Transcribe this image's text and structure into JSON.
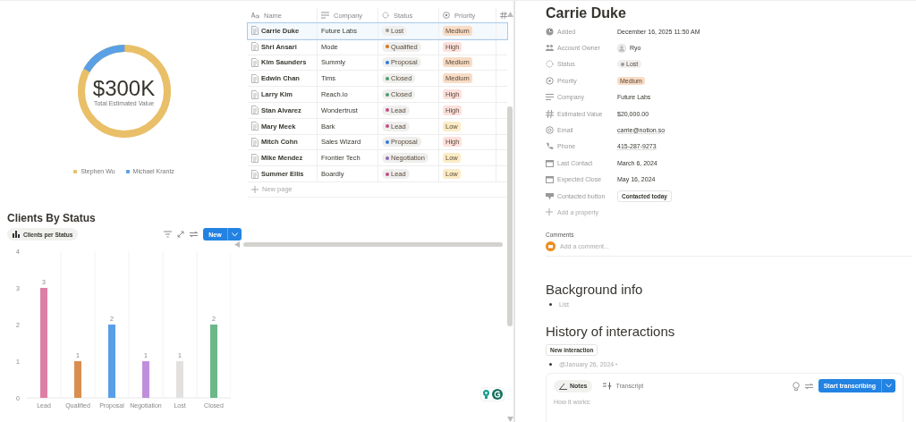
{
  "donut": {
    "value": "$300K",
    "caption": "Total Estimated Value",
    "legend": [
      {
        "name": "Stephen Wu",
        "color": "#e9bf68"
      },
      {
        "name": "Michael Krantz",
        "color": "#5aa0e6"
      }
    ]
  },
  "table": {
    "columns": [
      "Name",
      "Company",
      "Status",
      "Priority"
    ],
    "rows": [
      {
        "name": "Carrie Duke",
        "company": "Future Labs",
        "status": {
          "label": "Lost",
          "color": "#9b9a97"
        },
        "priority": {
          "label": "Medium",
          "color": "#f8dcc6"
        },
        "selected": true
      },
      {
        "name": "Shri Ansari",
        "company": "Mode",
        "status": {
          "label": "Qualified",
          "color": "#d9730d"
        },
        "priority": {
          "label": "High",
          "color": "#fde0dc"
        },
        "selected": false
      },
      {
        "name": "Kim Saunders",
        "company": "Summly",
        "status": {
          "label": "Proposal",
          "color": "#2e7dd7"
        },
        "priority": {
          "label": "Medium",
          "color": "#f8dcc6"
        },
        "selected": false
      },
      {
        "name": "Edwin Chan",
        "company": "Tims",
        "status": {
          "label": "Closed",
          "color": "#4d9a6c"
        },
        "priority": {
          "label": "Medium",
          "color": "#f8dcc6"
        },
        "selected": false
      },
      {
        "name": "Larry Kim",
        "company": "Reach.io",
        "status": {
          "label": "Closed",
          "color": "#4d9a6c"
        },
        "priority": {
          "label": "High",
          "color": "#fde0dc"
        },
        "selected": false
      },
      {
        "name": "Stan Alvarez",
        "company": "Wondertrust",
        "status": {
          "label": "Lead",
          "color": "#c14c8a"
        },
        "priority": {
          "label": "High",
          "color": "#fde0dc"
        },
        "selected": false
      },
      {
        "name": "Mary Meek",
        "company": "Bark",
        "status": {
          "label": "Lead",
          "color": "#c14c8a"
        },
        "priority": {
          "label": "Low",
          "color": "#fcecc6"
        },
        "selected": false
      },
      {
        "name": "Mitch Cohn",
        "company": "Sales Wizard",
        "status": {
          "label": "Proposal",
          "color": "#2e7dd7"
        },
        "priority": {
          "label": "High",
          "color": "#fde0dc"
        },
        "selected": false
      },
      {
        "name": "Mike Mendez",
        "company": "Frontier Tech",
        "status": {
          "label": "Negotiation",
          "color": "#9065b0"
        },
        "priority": {
          "label": "Low",
          "color": "#fcecc6"
        },
        "selected": false
      },
      {
        "name": "Summer Ellis",
        "company": "Boardly",
        "status": {
          "label": "Lead",
          "color": "#c14c8a"
        },
        "priority": {
          "label": "Low",
          "color": "#fcecc6"
        },
        "selected": false
      }
    ],
    "new_page": "New page"
  },
  "chart_section": {
    "title": "Clients By Status",
    "view_tab": "Clients per Status",
    "new_button": "New",
    "chart_data": {
      "type": "bar",
      "categories": [
        "Lead",
        "Qualified",
        "Proposal",
        "Negotiation",
        "Lost",
        "Closed"
      ],
      "values": [
        3,
        1,
        2,
        1,
        1,
        2
      ],
      "colors": [
        "#de7fa6",
        "#d98e4f",
        "#5a9ee8",
        "#c08fdc",
        "#e2e1df",
        "#6cb88a"
      ],
      "ylim": [
        0,
        4
      ],
      "yticks": [
        0,
        1,
        2,
        3,
        4
      ],
      "data_labels": true
    }
  },
  "record": {
    "title": "Carrie Duke",
    "properties": [
      {
        "kind": "date",
        "label": "Added",
        "value": "December 16, 2025 11:50 AM"
      },
      {
        "kind": "person",
        "label": "Account Owner",
        "value": "Ryo"
      },
      {
        "kind": "status",
        "label": "Status",
        "value": "Lost",
        "color": "#9b9a97"
      },
      {
        "kind": "priority",
        "label": "Priority",
        "value": "Medium",
        "color": "#f8dcc6"
      },
      {
        "kind": "text",
        "label": "Company",
        "value": "Future Labs"
      },
      {
        "kind": "number",
        "label": "Estimated Value",
        "value": "$20,000.00"
      },
      {
        "kind": "email",
        "label": "Email",
        "value": "carrie@notion.so"
      },
      {
        "kind": "phone",
        "label": "Phone",
        "value": "415-287-9273"
      },
      {
        "kind": "calendar",
        "label": "Last Contact",
        "value": "March 6, 2024"
      },
      {
        "kind": "calendar",
        "label": "Expected Close",
        "value": "May 16, 2024"
      },
      {
        "kind": "button",
        "label": "Contacted button",
        "value": "Contacted today"
      }
    ],
    "add_property": "Add a property",
    "comments_label": "Comments",
    "comment_placeholder": "Add a comment...",
    "background_heading": "Background info",
    "background_items": [
      "List"
    ],
    "history_heading": "History of interactions",
    "new_interaction": "New interaction",
    "history_items": [
      "@January 26, 2024 ‣"
    ],
    "notes": {
      "tabs": [
        {
          "label": "Notes",
          "selected": true
        },
        {
          "label": "Transcript",
          "selected": false
        }
      ],
      "start_button": "Start transcribing",
      "body": "How it works:"
    }
  }
}
